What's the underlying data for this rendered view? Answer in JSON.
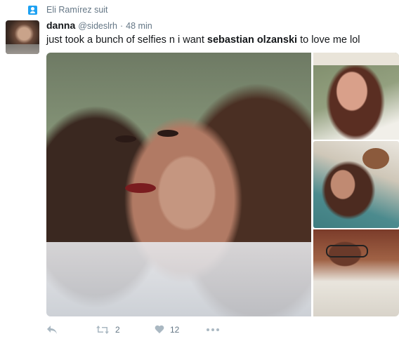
{
  "social_context": {
    "text": "Eli Ramírez suit",
    "icon": "follow-user-icon"
  },
  "tweet": {
    "author_name": "danna",
    "author_handle": "@sideslrh",
    "separator": "·",
    "timestamp": "48 min",
    "text_before": "just took a bunch of selfies n i want ",
    "text_bold": "sebastian olzanski",
    "text_after": " to love me lol"
  },
  "media": {
    "photo_count": 4
  },
  "actions": {
    "reply": {
      "icon": "reply-icon"
    },
    "retweet": {
      "icon": "retweet-icon",
      "count": "2"
    },
    "like": {
      "icon": "heart-icon",
      "count": "12"
    },
    "more": {
      "icon": "more-icon"
    }
  },
  "colors": {
    "accent": "#1da1f2",
    "muted": "#657786",
    "icon_gray": "#aab8c2",
    "text": "#14171a"
  }
}
